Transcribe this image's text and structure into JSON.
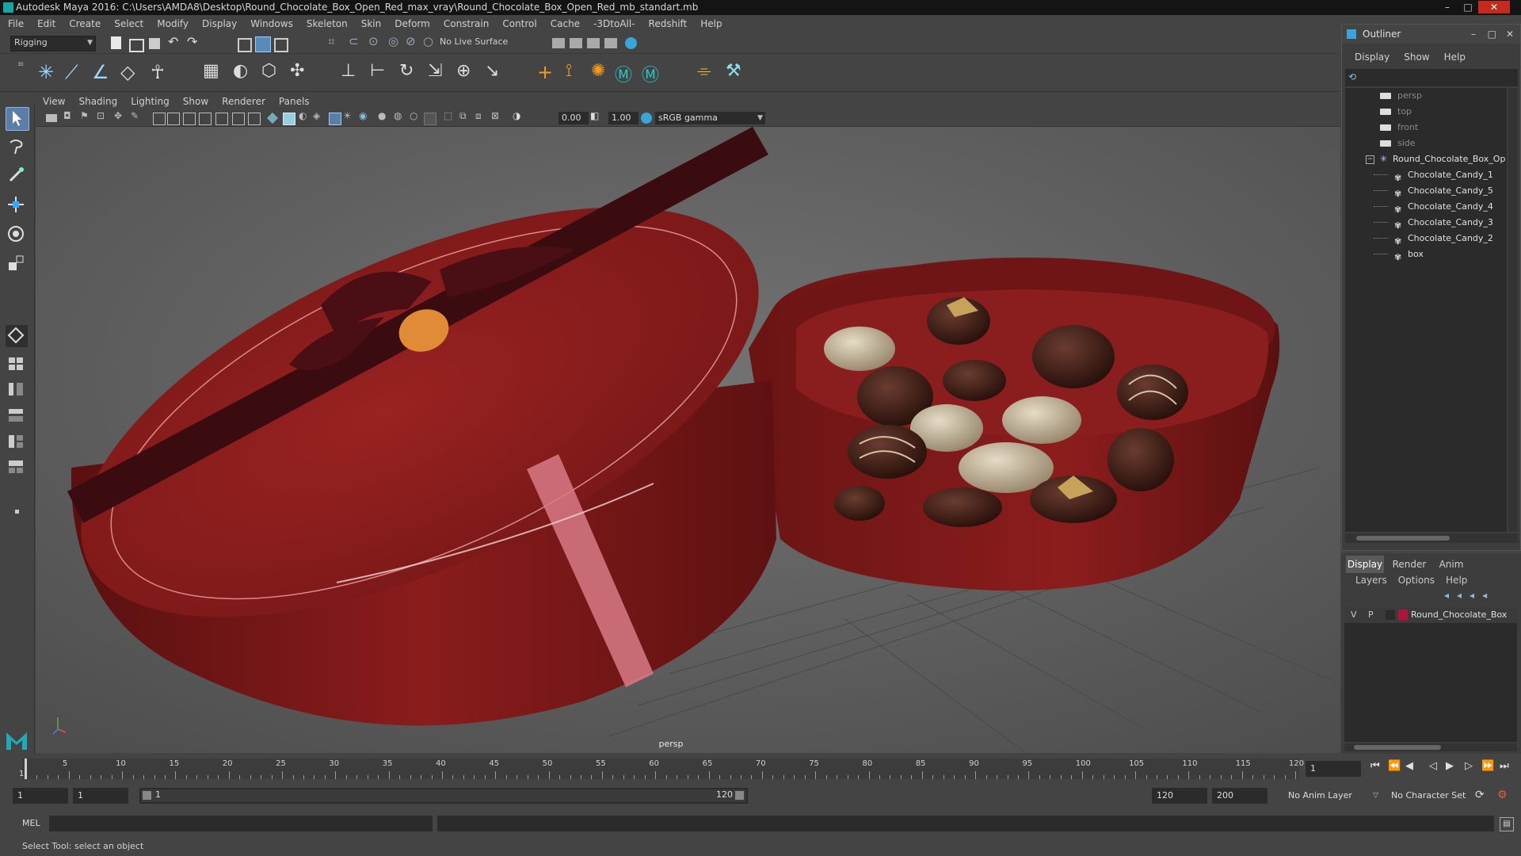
{
  "window": {
    "title": "Autodesk Maya 2016: C:\\Users\\AMDA8\\Desktop\\Round_Chocolate_Box_Open_Red_max_vray\\Round_Chocolate_Box_Open_Red_mb_standart.mb",
    "minimize": "–",
    "maximize": "□",
    "close": "✕"
  },
  "menubar": [
    "File",
    "Edit",
    "Create",
    "Select",
    "Modify",
    "Display",
    "Windows",
    "Skeleton",
    "Skin",
    "Deform",
    "Constrain",
    "Control",
    "Cache",
    "-3DtoAll-",
    "Redshift",
    "Help"
  ],
  "statusline": {
    "menuset": "Rigging",
    "live_surface": "No Live Surface"
  },
  "viewport": {
    "menus": [
      "View",
      "Shading",
      "Lighting",
      "Show",
      "Renderer",
      "Panels"
    ],
    "exposure": "0.00",
    "gamma": "1.00",
    "color_space": "sRGB gamma",
    "camera_label": "persp"
  },
  "outliner": {
    "title": "Outliner",
    "menus": [
      "Display",
      "Show",
      "Help"
    ],
    "items": [
      {
        "label": "persp",
        "kind": "camera",
        "dim": true
      },
      {
        "label": "top",
        "kind": "camera",
        "dim": true
      },
      {
        "label": "front",
        "kind": "camera",
        "dim": true
      },
      {
        "label": "side",
        "kind": "camera",
        "dim": true
      },
      {
        "label": "Round_Chocolate_Box_Op",
        "kind": "group",
        "dim": false
      },
      {
        "label": "Chocolate_Candy_1",
        "kind": "mesh",
        "dim": false
      },
      {
        "label": "Chocolate_Candy_5",
        "kind": "mesh",
        "dim": false
      },
      {
        "label": "Chocolate_Candy_4",
        "kind": "mesh",
        "dim": false
      },
      {
        "label": "Chocolate_Candy_3",
        "kind": "mesh",
        "dim": false
      },
      {
        "label": "Chocolate_Candy_2",
        "kind": "mesh",
        "dim": false
      },
      {
        "label": "box",
        "kind": "mesh",
        "dim": false
      }
    ]
  },
  "layer_editor": {
    "tabs": [
      "Display",
      "Render",
      "Anim"
    ],
    "menus": [
      "Layers",
      "Options",
      "Help"
    ],
    "layer": {
      "v": "V",
      "p": "P",
      "name": "Round_Chocolate_Box",
      "color": "#b0143a"
    }
  },
  "timeline": {
    "ticks": [
      "5",
      "10",
      "15",
      "20",
      "25",
      "30",
      "35",
      "40",
      "45",
      "50",
      "55",
      "60",
      "65",
      "70",
      "75",
      "80",
      "85",
      "90",
      "95",
      "100",
      "105",
      "110",
      "115",
      "120"
    ],
    "start_marker": "1",
    "current_frame": "1"
  },
  "range": {
    "start": "1",
    "playback_start": "1",
    "slider_start": "1",
    "slider_end": "120",
    "playback_end": "120",
    "end": "200",
    "anim_layer": "No Anim Layer",
    "character_set": "No Character Set"
  },
  "cmdline": {
    "label": "MEL"
  },
  "helpline": {
    "text": "Select Tool: select an object"
  }
}
